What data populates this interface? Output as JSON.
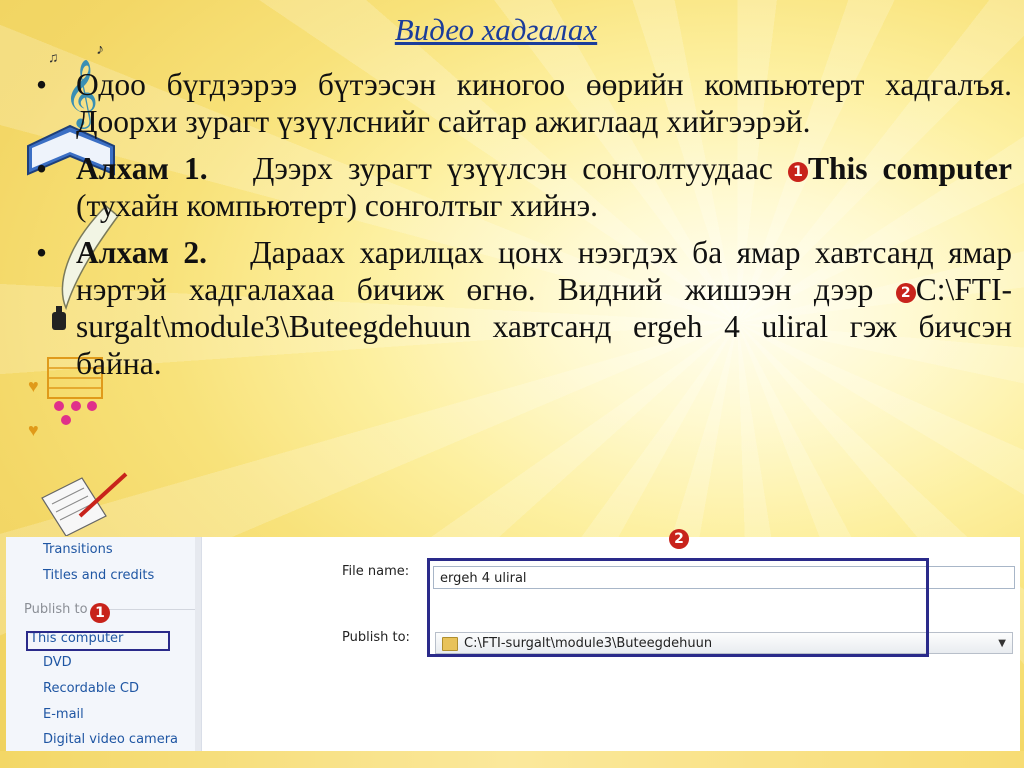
{
  "title": "Видео хадгалах",
  "bullets": {
    "b1_text": "Одоо бүгдээрээ бүтээсэн киногоо өөрийн компьютерт хадгалъя. Доорхи зурагт үзүүлснийг сайтар ажиглаад хийгээрэй.",
    "b2_step": "Алхам 1.",
    "b2_text_a": "Дээрх зурагт үзүүлсэн сонголтуудаас",
    "b2_marker": "1",
    "b2_bold": "This computer",
    "b2_text_b": "(тухайн компьютерт) сонголтыг хийнэ.",
    "b3_step": "Алхам 2.",
    "b3_text_a": "Дараах харилцах цонх нээгдэх ба ямар хавтсанд ямар нэртэй хадгалахаа бичиж өгнө. Видний жишээн дээр",
    "b3_marker": "2",
    "b3_text_b": "C:\\FTI-surgalt\\module3\\Buteegdehuun хавтсанд ergeh 4 uliral гэж бичсэн байна."
  },
  "left_pane": {
    "items_top": [
      "Transitions",
      "Titles and credits"
    ],
    "section_header": "Publish to",
    "marker": "1",
    "items": [
      "This computer",
      "DVD",
      "Recordable CD",
      "E-mail",
      "Digital video camera"
    ]
  },
  "dialog": {
    "marker": "2",
    "file_name_label": "File name:",
    "file_name_value": "ergeh 4 uliral",
    "publish_to_label": "Publish to:",
    "publish_to_value": "C:\\FTI-surgalt\\module3\\Buteegdehuun"
  },
  "icons": [
    "music-notes-icon",
    "treble-clef-icon",
    "book-icon",
    "quill-pen-icon",
    "ink-bottle-icon",
    "music-staff-icon",
    "sheet-paper-icon",
    "red-pencil-icon",
    "chevron-down-icon",
    "folder-icon"
  ],
  "colors": {
    "title": "#1b3d9b",
    "marker": "#c8231b",
    "highlight_box": "#2a2a8a",
    "link_blue": "#1f56a3"
  }
}
